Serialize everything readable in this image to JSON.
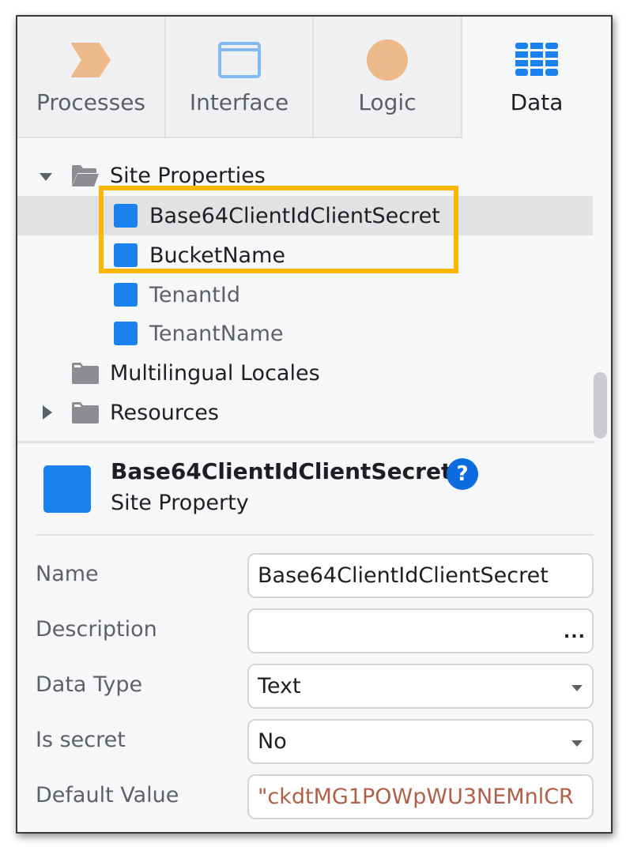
{
  "tabs": [
    {
      "label": "Processes",
      "icon": "processes-chevron-icon",
      "active": false
    },
    {
      "label": "Interface",
      "icon": "interface-window-icon",
      "active": false
    },
    {
      "label": "Logic",
      "icon": "logic-circle-icon",
      "active": false
    },
    {
      "label": "Data",
      "icon": "data-table-icon",
      "active": true
    }
  ],
  "tree": {
    "site_properties": {
      "label": "Site Properties",
      "expanded": true,
      "items": [
        {
          "label": "Base64ClientIdClientSecret",
          "selected": true,
          "highlighted": true
        },
        {
          "label": "BucketName",
          "selected": false,
          "highlighted": true
        },
        {
          "label": "TenantId",
          "selected": false,
          "highlighted": false
        },
        {
          "label": "TenantName",
          "selected": false,
          "highlighted": false
        }
      ]
    },
    "multilingual_locales": {
      "label": "Multilingual Locales"
    },
    "resources": {
      "label": "Resources",
      "expanded": false
    }
  },
  "properties": {
    "title": "Base64ClientIdClientSecret",
    "subtitle": "Site Property",
    "help_icon": "?",
    "fields": {
      "name": {
        "label": "Name",
        "value": "Base64ClientIdClientSecret"
      },
      "description": {
        "label": "Description",
        "value": "",
        "more": "..."
      },
      "data_type": {
        "label": "Data Type",
        "value": "Text"
      },
      "is_secret": {
        "label": "Is secret",
        "value": "No"
      },
      "default_value": {
        "label": "Default Value",
        "value": "\"ckdtMG1POWpWU3NEMnlCR"
      }
    }
  },
  "colors": {
    "accent_blue": "#1a82ee",
    "highlight": "#fbb700",
    "orange_icon": "#edb88a",
    "default_value_text": "#b0604a"
  }
}
